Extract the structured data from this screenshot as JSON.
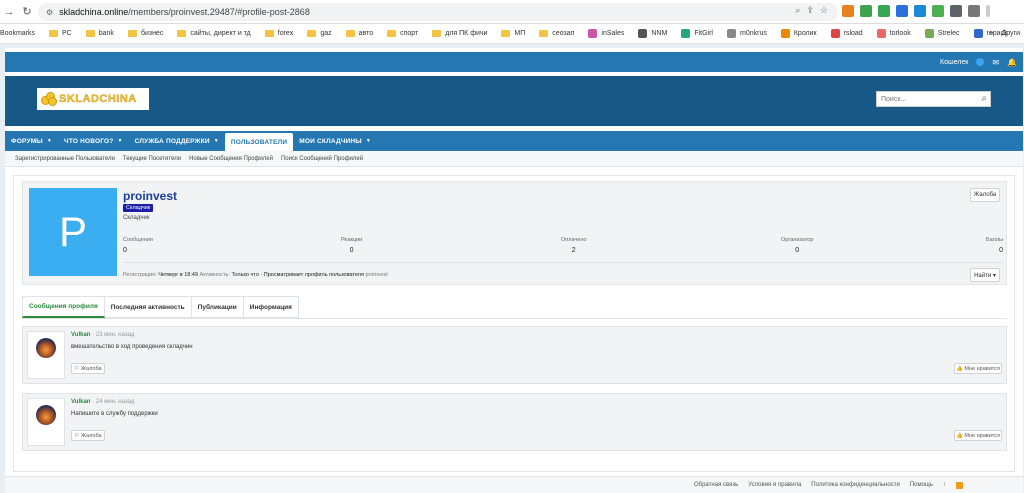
{
  "browser": {
    "url_host": "skladchina.online",
    "url_path": "/members/proinvest.29487/#profile-post-2868",
    "bookmarks": [
      {
        "label": "Bookmarks",
        "kind": "plain"
      },
      {
        "label": "PC",
        "kind": "folder"
      },
      {
        "label": "bank",
        "kind": "folder"
      },
      {
        "label": "бизнес",
        "kind": "folder"
      },
      {
        "label": "сайты, директ и тд",
        "kind": "folder"
      },
      {
        "label": "forex",
        "kind": "folder"
      },
      {
        "label": "gaz",
        "kind": "folder"
      },
      {
        "label": "авто",
        "kind": "folder"
      },
      {
        "label": "спорт",
        "kind": "folder"
      },
      {
        "label": "для ПК фичи",
        "kind": "folder"
      },
      {
        "label": "МП",
        "kind": "folder"
      },
      {
        "label": "сеозап",
        "kind": "folder"
      },
      {
        "label": "inSales",
        "kind": "site"
      },
      {
        "label": "NNM",
        "kind": "site"
      },
      {
        "label": "FitGirl",
        "kind": "site"
      },
      {
        "label": "m0nkrus",
        "kind": "site"
      },
      {
        "label": "Кролик",
        "kind": "site"
      },
      {
        "label": "rsload",
        "kind": "site"
      },
      {
        "label": "torlook",
        "kind": "site"
      },
      {
        "label": "Strelec",
        "kind": "site"
      },
      {
        "label": "repack",
        "kind": "site"
      }
    ],
    "bookmarks_more": "»",
    "bookmarks_other": "Други"
  },
  "topbar": {
    "wallet": "Кошелек"
  },
  "header": {
    "logo_text": "SKLADCHINA",
    "search_placeholder": "Поиск..."
  },
  "nav": {
    "tabs": [
      {
        "label": "ФОРУМЫ",
        "caret": true,
        "active": false
      },
      {
        "label": "ЧТО НОВОГО?",
        "caret": true,
        "active": false
      },
      {
        "label": "СЛУЖБА ПОДДЕРЖКИ",
        "caret": true,
        "active": false
      },
      {
        "label": "ПОЛЬЗОВАТЕЛИ",
        "caret": false,
        "active": true
      },
      {
        "label": "МОИ СКЛАДЧИНЫ",
        "caret": true,
        "active": false
      }
    ],
    "subnav": [
      "Зарегистрированные Пользователи",
      "Текущие Посетители",
      "Новые Сообщения Профилей",
      "Поиск Сообщений Профилей"
    ]
  },
  "profile": {
    "avatar_letter": "P",
    "name": "proinvest",
    "badge": "Складчик",
    "title": "Складчик",
    "report_label": "Жалоба",
    "stats": [
      {
        "label": "Сообщения",
        "value": "0"
      },
      {
        "label": "Реакции",
        "value": "0"
      },
      {
        "label": "Оплачено",
        "value": "2"
      },
      {
        "label": "Организатор",
        "value": "0"
      },
      {
        "label": "Баллы",
        "value": "0"
      }
    ],
    "reg_label": "Регистрация:",
    "reg_value": "Четверг в 18:49",
    "activity_label": "Активность:",
    "activity_value": "Только что",
    "activity_detail": "· Просматривает профиль пользователя",
    "activity_user": "proinvest",
    "find_label": "Найти ▾"
  },
  "tabs": [
    {
      "label": "Сообщения профиля",
      "active": true
    },
    {
      "label": "Последняя активность",
      "active": false
    },
    {
      "label": "Публикации",
      "active": false
    },
    {
      "label": "Информация",
      "active": false
    }
  ],
  "posts": [
    {
      "user": "Vulkan",
      "time": "· 23 мин. назад",
      "text": "вмешательство в ход проведения складчин",
      "report": "⚐ Жалоба",
      "like": "👍 Мне нравится"
    },
    {
      "user": "Vulkan",
      "time": "· 24 мин. назад",
      "text": "Напишите в службу поддержки",
      "report": "⚐ Жалоба",
      "like": "👍 Мне нравится"
    }
  ],
  "footer": {
    "links": [
      "Обратная связь",
      "Условия и правила",
      "Политика конфиденциальности",
      "Помощь"
    ],
    "up": "↑"
  }
}
